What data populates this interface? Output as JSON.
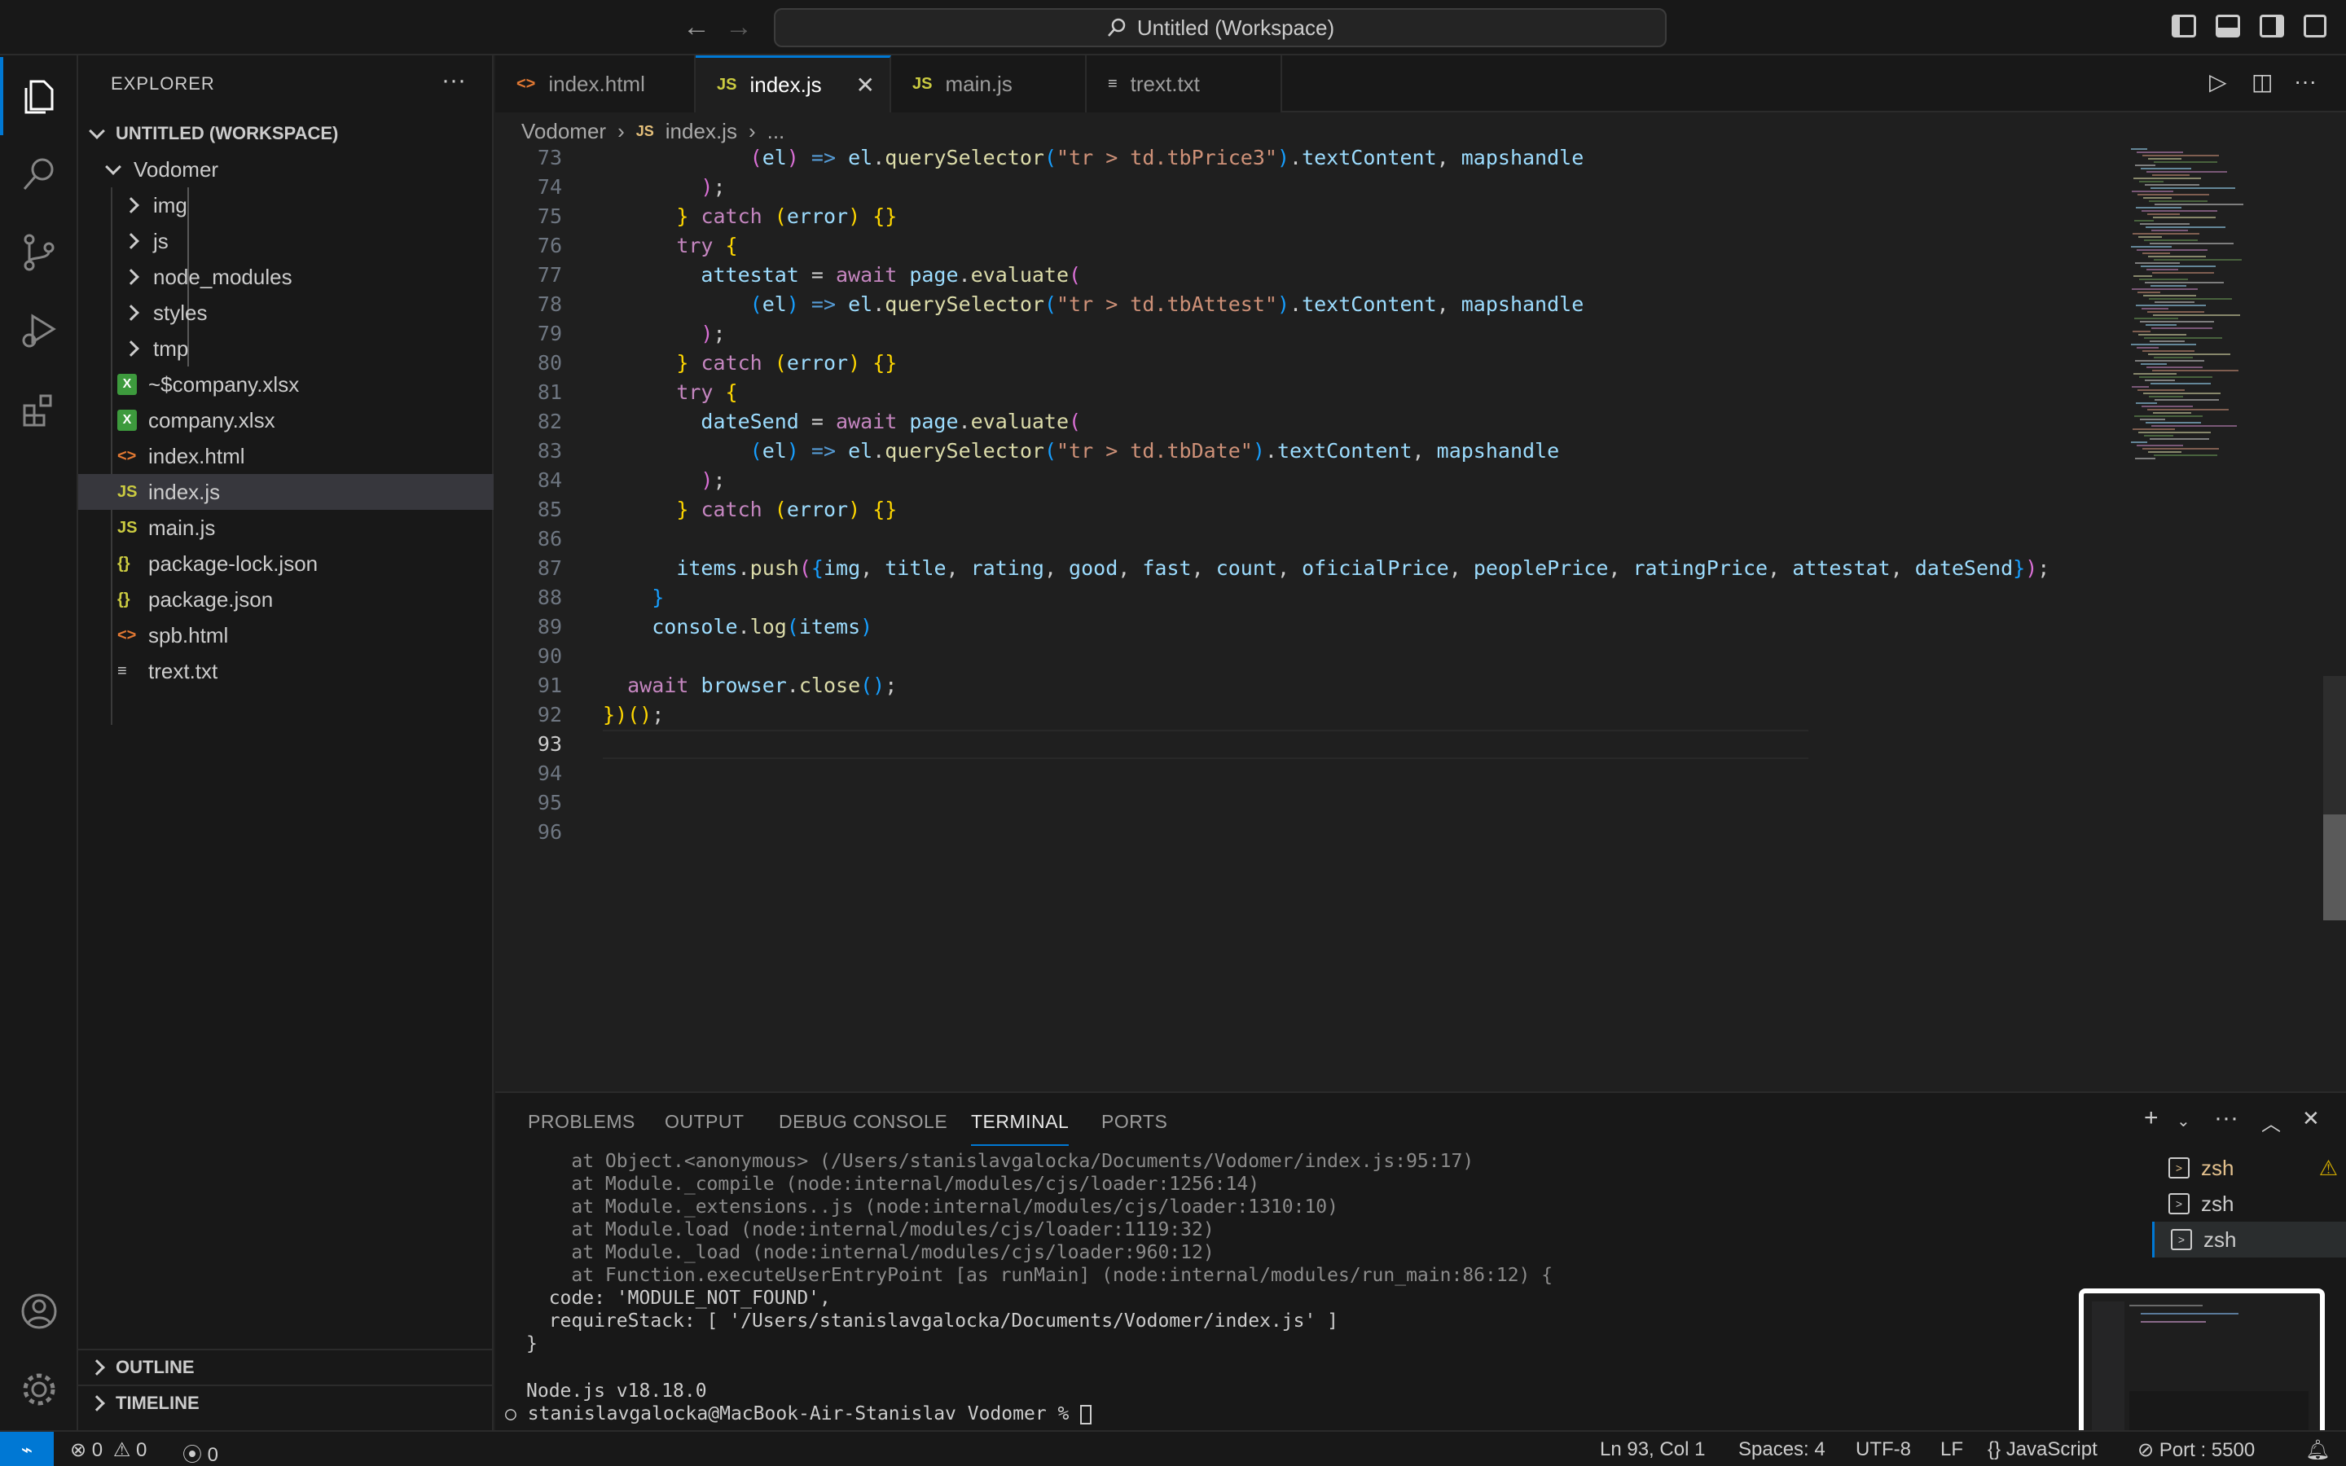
{
  "titlebar": {
    "search_label": "Untitled (Workspace)",
    "back_icon": "arrow-left-icon",
    "forward_icon": "arrow-right-icon"
  },
  "sidebar": {
    "title": "EXPLORER",
    "more": "···",
    "workspace": "UNTITLED (WORKSPACE)",
    "root_folder": "Vodomer",
    "items": [
      {
        "label": "img",
        "kind": "folder"
      },
      {
        "label": "js",
        "kind": "folder"
      },
      {
        "label": "node_modules",
        "kind": "folder"
      },
      {
        "label": "styles",
        "kind": "folder"
      },
      {
        "label": "tmp",
        "kind": "folder"
      },
      {
        "label": "~$company.xlsx",
        "kind": "xlsx"
      },
      {
        "label": "company.xlsx",
        "kind": "xlsx"
      },
      {
        "label": "index.html",
        "kind": "html"
      },
      {
        "label": "index.js",
        "kind": "js",
        "selected": true
      },
      {
        "label": "main.js",
        "kind": "js"
      },
      {
        "label": "package-lock.json",
        "kind": "json"
      },
      {
        "label": "package.json",
        "kind": "json"
      },
      {
        "label": "spb.html",
        "kind": "html"
      },
      {
        "label": "trext.txt",
        "kind": "txt"
      }
    ],
    "outline": "OUTLINE",
    "timeline": "TIMELINE"
  },
  "tabs": [
    {
      "icon": "<>",
      "label": "index.html",
      "active": false
    },
    {
      "icon": "JS",
      "label": "index.js",
      "active": true
    },
    {
      "icon": "JS",
      "label": "main.js",
      "active": false
    },
    {
      "icon": "≡",
      "label": "trext.txt",
      "active": false
    }
  ],
  "breadcrumb": {
    "folder": "Vodomer",
    "file_icon": "JS",
    "file": "index.js",
    "more": "..."
  },
  "editor": {
    "lines": [
      {
        "n": "73",
        "html": "            <span class='pv'>(</span><span class='vr'>el</span><span class='pv'>)</span> <span class='ar'>=></span> <span class='vr'>el</span>.<span class='fn'>querySelector</span><span class='pb'>(</span><span class='st1'>\"tr > td.tbPrice3\"</span><span class='pb'>)</span>.<span class='vr'>textContent</span>, <span class='vr'>mapshandle</span>"
      },
      {
        "n": "74",
        "html": "        <span class='pv'>)</span>;"
      },
      {
        "n": "75",
        "html": "      <span class='pr'>}</span> <span class='kw'>catch</span> <span class='pr'>(</span><span class='vr'>error</span><span class='pr'>)</span> <span class='pr'>{}</span>"
      },
      {
        "n": "76",
        "html": "      <span class='kw'>try</span> <span class='pr'>{</span>"
      },
      {
        "n": "77",
        "html": "        <span class='vr'>attestat</span> = <span class='kw'>await</span> <span class='vr'>page</span>.<span class='fn'>evaluate</span><span class='pv'>(</span>"
      },
      {
        "n": "78",
        "html": "            <span class='pb'>(</span><span class='vr'>el</span><span class='pb'>)</span> <span class='ar'>=></span> <span class='vr'>el</span>.<span class='fn'>querySelector</span><span class='pb'>(</span><span class='st1'>\"tr > td.tbAttest\"</span><span class='pb'>)</span>.<span class='vr'>textContent</span>, <span class='vr'>mapshandle</span>"
      },
      {
        "n": "79",
        "html": "        <span class='pv'>)</span>;"
      },
      {
        "n": "80",
        "html": "      <span class='pr'>}</span> <span class='kw'>catch</span> <span class='pr'>(</span><span class='vr'>error</span><span class='pr'>)</span> <span class='pr'>{}</span>"
      },
      {
        "n": "81",
        "html": "      <span class='kw'>try</span> <span class='pr'>{</span>"
      },
      {
        "n": "82",
        "html": "        <span class='vr'>dateSend</span> = <span class='kw'>await</span> <span class='vr'>page</span>.<span class='fn'>evaluate</span><span class='pv'>(</span>"
      },
      {
        "n": "83",
        "html": "            <span class='pb'>(</span><span class='vr'>el</span><span class='pb'>)</span> <span class='ar'>=></span> <span class='vr'>el</span>.<span class='fn'>querySelector</span><span class='pb'>(</span><span class='st1'>\"tr > td.tbDate\"</span><span class='pb'>)</span>.<span class='vr'>textContent</span>, <span class='vr'>mapshandle</span>"
      },
      {
        "n": "84",
        "html": "        <span class='pv'>)</span>;"
      },
      {
        "n": "85",
        "html": "      <span class='pr'>}</span> <span class='kw'>catch</span> <span class='pr'>(</span><span class='vr'>error</span><span class='pr'>)</span> <span class='pr'>{}</span>"
      },
      {
        "n": "86",
        "html": ""
      },
      {
        "n": "87",
        "html": "      <span class='vr'>items</span>.<span class='fn'>push</span><span class='pv'>(</span><span class='pb'>{</span><span class='vr'>img</span>, <span class='vr'>title</span>, <span class='vr'>rating</span>, <span class='vr'>good</span>, <span class='vr'>fast</span>, <span class='vr'>count</span>, <span class='vr'>oficialPrice</span>, <span class='vr'>peoplePrice</span>, <span class='vr'>ratingPrice</span>, <span class='vr'>attestat</span>, <span class='vr'>dateSend</span><span class='pb'>}</span><span class='pv'>)</span>;"
      },
      {
        "n": "88",
        "html": "    <span class='pb'>}</span>"
      },
      {
        "n": "89",
        "html": "    <span class='vr'>console</span>.<span class='fn'>log</span><span class='pb'>(</span><span class='vr'>items</span><span class='pb'>)</span>"
      },
      {
        "n": "90",
        "html": ""
      },
      {
        "n": "91",
        "html": "  <span class='kw'>await</span> <span class='vr'>browser</span>.<span class='fn'>close</span><span class='pb'>()</span>;"
      },
      {
        "n": "92",
        "html": "<span class='pr'>}</span><span class='pr'>)</span><span class='pr'>()</span>;"
      },
      {
        "n": "93",
        "html": ""
      },
      {
        "n": "94",
        "html": ""
      },
      {
        "n": "95",
        "html": ""
      },
      {
        "n": "96",
        "html": ""
      }
    ],
    "current_line": "93"
  },
  "panel": {
    "tabs": [
      "PROBLEMS",
      "OUTPUT",
      "DEBUG CONSOLE",
      "TERMINAL",
      "PORTS"
    ],
    "active_tab": "TERMINAL",
    "terminal_lines": [
      "    at Object.<anonymous> (/Users/stanislavgalocka/Documents/Vodomer/index.js:95:17)",
      "    at Module._compile (node:internal/modules/cjs/loader:1256:14)",
      "    at Module._extensions..js (node:internal/modules/cjs/loader:1310:10)",
      "    at Module.load (node:internal/modules/cjs/loader:1119:32)",
      "    at Module._load (node:internal/modules/cjs/loader:960:12)",
      "    at Function.executeUserEntryPoint [as runMain] (node:internal/modules/run_main:86:12) {",
      "  code: 'MODULE_NOT_FOUND',",
      "  requireStack: [ '/Users/stanislavgalocka/Documents/Vodomer/index.js' ]",
      "}",
      "",
      "Node.js v18.18.0",
      "stanislavgalocka@MacBook-Air-Stanislav Vodomer % "
    ],
    "terminals": [
      {
        "label": "zsh",
        "warn": true
      },
      {
        "label": "zsh",
        "warn": false
      },
      {
        "label": "zsh",
        "warn": false
      }
    ]
  },
  "statusbar": {
    "errors": "0",
    "warnings": "0",
    "ports": "0",
    "position": "Ln 93, Col 1",
    "spaces": "Spaces: 4",
    "encoding": "UTF-8",
    "eol": "LF",
    "language": "JavaScript",
    "port": "Port : 5500"
  },
  "colors": {
    "accent": "#0078d4",
    "background": "#1f1f1f",
    "sidebar": "#181818"
  }
}
